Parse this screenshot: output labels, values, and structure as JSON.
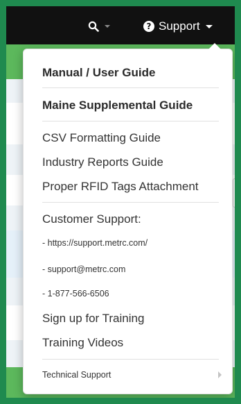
{
  "navbar": {
    "support_label": "Support"
  },
  "menu": {
    "manual": "Manual / User Guide",
    "maine": "Maine Supplemental Guide",
    "csv": "CSV Formatting Guide",
    "industry": "Industry Reports Guide",
    "rfid": "Proper RFID Tags Attachment",
    "customer_support_heading": "Customer Support:",
    "support_url": "- https://support.metrc.com/",
    "support_email": "- support@metrc.com",
    "support_phone": "- 1-877-566-6506",
    "training_signup": "Sign up for Training",
    "training_videos": "Training Videos",
    "technical_support": "Technical Support"
  },
  "colors": {
    "frame_green": "#1f8a4f",
    "navbar_black": "#111111",
    "accent_green": "#5cb85c"
  },
  "icons": {
    "search": "search-icon",
    "question": "question-circle-icon",
    "caret": "caret-down-icon",
    "submenu": "caret-right-icon"
  }
}
